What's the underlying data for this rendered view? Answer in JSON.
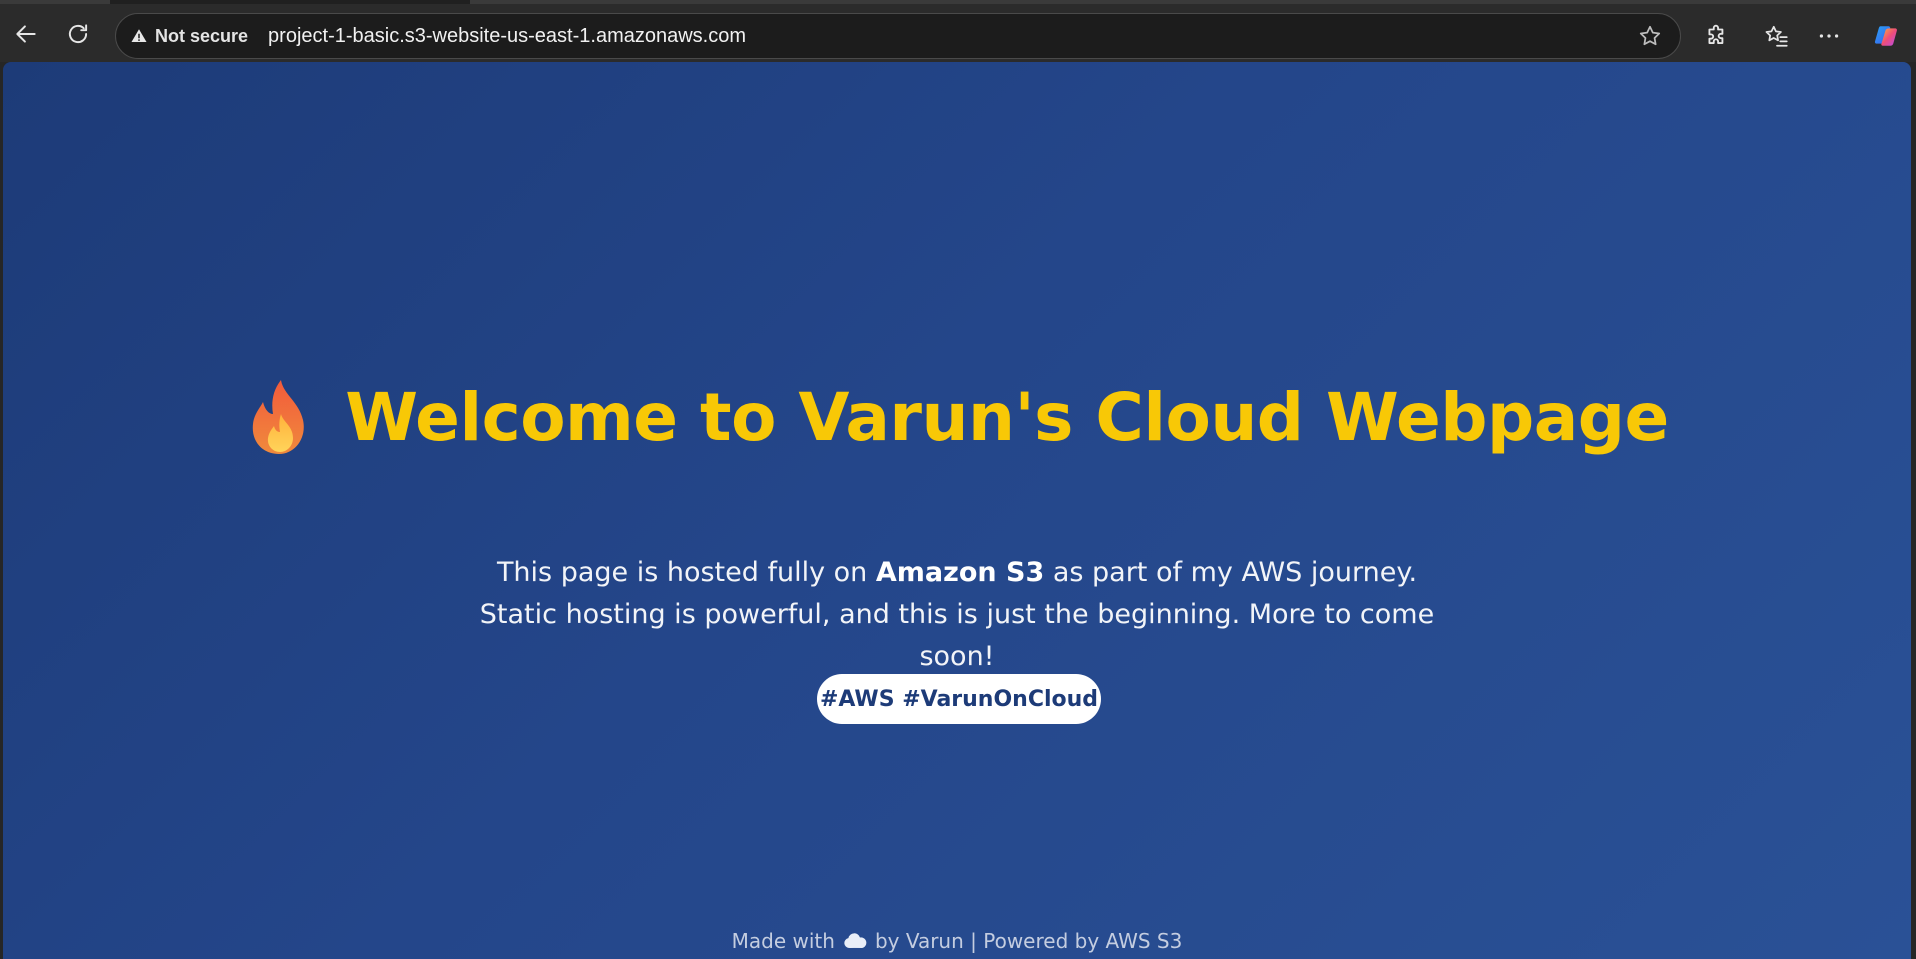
{
  "browser": {
    "security_label": "Not secure",
    "url": "project-1-basic.s3-website-us-east-1.amazonaws.com",
    "icons": {
      "back": "arrow-left-icon",
      "reload": "reload-icon",
      "security": "warning-triangle-icon",
      "favorite": "star-icon",
      "extensions": "puzzle-icon",
      "favorites": "favorites-list-icon",
      "more": "ellipsis-icon",
      "copilot": "copilot-icon"
    }
  },
  "page": {
    "title_emoji": "fire-icon",
    "title": "Welcome to Varun's Cloud Webpage",
    "paragraph_before": "This page is hosted fully on ",
    "paragraph_bold": "Amazon S3",
    "paragraph_after": " as part of my AWS journey. Static hosting is powerful, and this is just the beginning. More to come soon!",
    "hashtags": "#AWS #VarunOnCloud",
    "footer_before": "Made with",
    "footer_after": "by Varun | Powered by AWS S3",
    "colors": {
      "background_start": "#1d3b78",
      "background_end": "#2a5196",
      "title": "#f8c806",
      "text": "#f2f4f8"
    }
  }
}
